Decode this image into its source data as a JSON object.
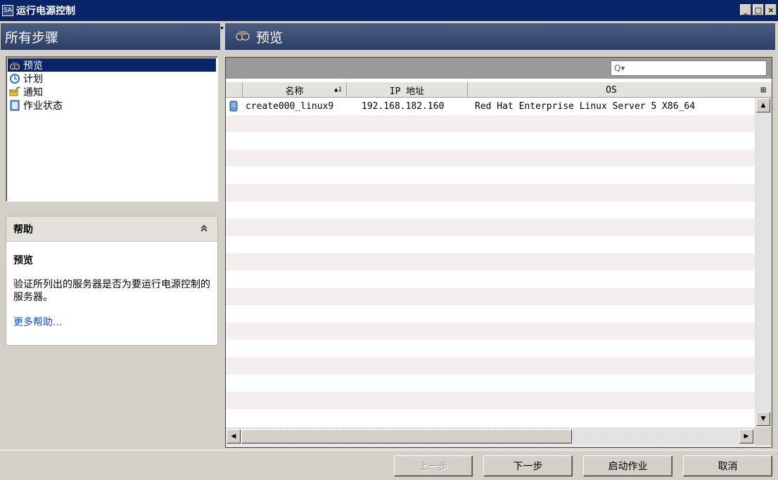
{
  "window": {
    "app_icon_text": "SA",
    "title": "运行电源控制",
    "minimize": "_",
    "maximize": "□",
    "close": "×"
  },
  "left": {
    "steps_header": "所有步骤",
    "steps": [
      {
        "label": "预览",
        "icon": "binoculars-icon",
        "selected": true
      },
      {
        "label": "计划",
        "icon": "clock-icon",
        "selected": false
      },
      {
        "label": "通知",
        "icon": "envelope-icon",
        "selected": false
      },
      {
        "label": "作业状态",
        "icon": "job-status-icon",
        "selected": false
      }
    ],
    "help": {
      "header": "帮助",
      "collapse_glyph": "≈",
      "title": "预览",
      "text": "验证所列出的服务器是否为要运行电源控制的服务器。",
      "link": "更多帮助..."
    }
  },
  "right": {
    "header": "预览",
    "search_placeholder": "Q▾",
    "columns": [
      {
        "label": "名称",
        "sort": "▲1"
      },
      {
        "label": "IP 地址",
        "sort": ""
      },
      {
        "label": "OS",
        "sort": ""
      }
    ],
    "column_picker_glyph": "⊞",
    "rows": [
      {
        "name": "create000_linux9",
        "ip": "192.168.182.160",
        "os": "Red Hat Enterprise Linux Server 5 X86_64"
      }
    ]
  },
  "footer": {
    "back": "上一步",
    "next": "下一步",
    "start_job": "启动作业",
    "cancel": "取消"
  },
  "colors": {
    "titlebar": "#0a246a",
    "header_gradient_top": "#4a5d83",
    "header_gradient_bottom": "#2e3f67",
    "selection": "#0a246a",
    "link": "#1a4ed8",
    "row_stripe": "#f5eeee"
  }
}
